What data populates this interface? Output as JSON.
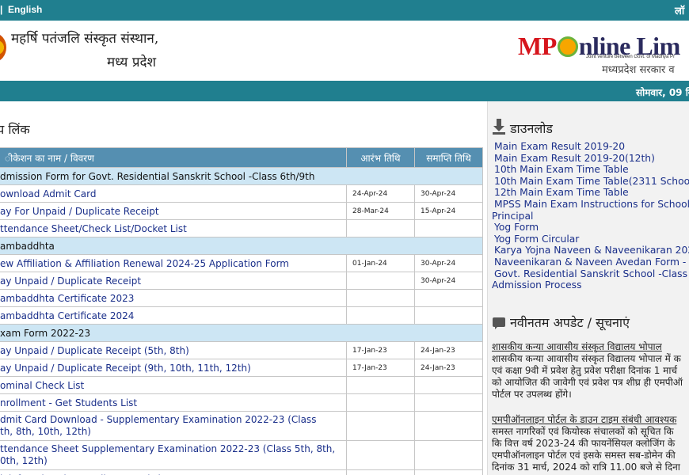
{
  "topbar": {
    "separator": "|",
    "language": "English",
    "login": "लॉ"
  },
  "header": {
    "org_line1": "महर्षि पतंजलि संस्कृत संस्थान,",
    "org_line2": "मध्य प्रदेश",
    "logo": {
      "mp": "MP",
      "rest": "nline Lim"
    },
    "joint_venture": "Joint venture between Govt. of Madhya Pr",
    "gov_text": "मध्यप्रदेश सरकार व"
  },
  "datebar": {
    "date": "सोमवार, 09 सि"
  },
  "main": {
    "section_title": "य लिंक",
    "table": {
      "headers": [
        "ीकेशन का नाम / विवरण",
        "आरंभ तिथि",
        "समाप्ति तिथि"
      ],
      "rows": [
        {
          "type": "cat",
          "name": "dmission Form for Govt. Residential Sanskrit School -Class 6th/9th"
        },
        {
          "type": "row",
          "name": "ownload Admit Card",
          "start": "24-Apr-24",
          "end": "30-Apr-24"
        },
        {
          "type": "row",
          "name": "ay For Unpaid / Duplicate Receipt",
          "start": "28-Mar-24",
          "end": "15-Apr-24"
        },
        {
          "type": "row",
          "name": "ttendance Sheet/Check List/Docket List",
          "start": "",
          "end": ""
        },
        {
          "type": "cat",
          "name": "ambaddhta"
        },
        {
          "type": "row",
          "name": "ew Affiliation & Affiliation Renewal 2024-25 Application Form",
          "start": "01-Jan-24",
          "end": "30-Apr-24"
        },
        {
          "type": "row",
          "name": "ay Unpaid / Duplicate Receipt",
          "start": "",
          "end": "30-Apr-24"
        },
        {
          "type": "row",
          "name": "ambaddhta Certificate 2023",
          "start": "",
          "end": ""
        },
        {
          "type": "row",
          "name": "ambaddhta Certificate 2024",
          "start": "",
          "end": ""
        },
        {
          "type": "cat",
          "name": "xam Form 2022-23"
        },
        {
          "type": "row",
          "name": "ay Unpaid / Duplicate Receipt (5th, 8th)",
          "start": "17-Jan-23",
          "end": "24-Jan-23"
        },
        {
          "type": "row",
          "name": "ay Unpaid / Duplicate Receipt (9th, 10th, 11th, 12th)",
          "start": "17-Jan-23",
          "end": "24-Jan-23"
        },
        {
          "type": "row",
          "name": "ominal Check List",
          "start": "",
          "end": ""
        },
        {
          "type": "row",
          "name": "nrollment - Get Students List",
          "start": "",
          "end": ""
        },
        {
          "type": "tall",
          "name": "dmit Card Download - Supplementary Examination 2022-23 (Class",
          "name2": "th, 8th, 10th, 12th)",
          "start": "",
          "end": ""
        },
        {
          "type": "tall",
          "name": "ttendance Sheet Supplementary Examination 2022-23 (Class 5th, 8th,",
          "name2": "0th, 12th)",
          "start": "",
          "end": ""
        },
        {
          "type": "row",
          "name": "ink for Migration/Duplicate Marksheet",
          "start": "",
          "end": ""
        }
      ]
    }
  },
  "sidebar": {
    "downloads_title": "डाउनलोड",
    "downloads": [
      "Main Exam Result 2019-20",
      "Main Exam Result 2019-20(12th)",
      "10th Main Exam Time Table",
      "10th Main Exam Time Table(2311 School",
      "12th Main Exam Time Table",
      "MPSS Main Exam Instructions for School Principal",
      "Yog Form",
      "Yog Form Circular",
      "Karya Yojna Naveen & Naveenikaran 202",
      "Naveenikaran & Naveen Avedan Form - 2",
      "Govt. Residential Sanskrit School -Class 6 Admission Process"
    ],
    "updates_title": "नवीनतम अपडेट / सूचनाएं",
    "news": [
      {
        "title": "शासकीय कन्या आवासीय संस्कृत विद्यालय भोपाल",
        "lines": [
          "शासकीय कन्या आवासीय संस्कृत विद्यालय भोपाल में क",
          "एवं कक्षा 9वी में प्रवेश हेतु प्रवेश परीक्षा दिनांक 1 मार्च",
          "को आयोजित की जावेगी एवं प्रवेश पत्र शीघ्र ही एमपीऑ",
          "पोर्टल पर उपलब्ध होंगे।"
        ]
      },
      {
        "title": "एमपीऑनलाइन पोर्टल के डाउन टाइम संबंधी आवश्यक",
        "lines": [
          "समस्त नागरिकों एवं कियोस्क संचालकों को सूचित कि",
          "कि वित्त वर्ष 2023-24 की फायनेंसियल क्लोजिंग के",
          "एमपीऑनलाइन पोर्टल एवं इसके समस्त सब-डोमेन की",
          "दिनांक 31 मार्च, 2024 को रात्रि 11.00 बजे से दिना"
        ]
      }
    ]
  }
}
